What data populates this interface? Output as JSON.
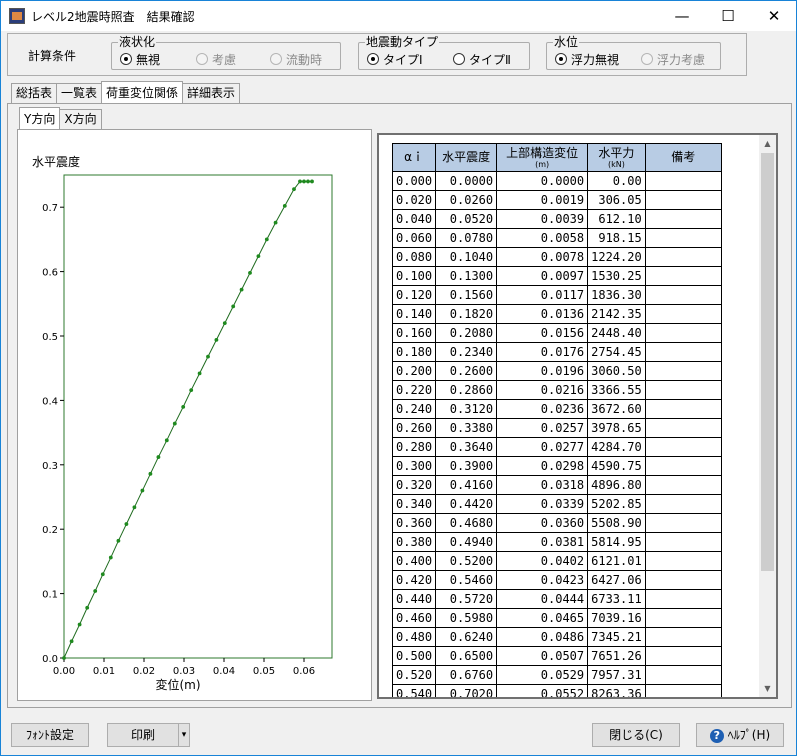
{
  "window": {
    "title": "レベル2地震時照査　結果確認",
    "minimize": "—",
    "maximize": "☐",
    "close": "✕"
  },
  "conditions": {
    "label": "計算条件",
    "liquefaction": {
      "title": "液状化",
      "options": [
        "無視",
        "考慮",
        "流動時"
      ],
      "selected": 0
    },
    "motion": {
      "title": "地震動タイプ",
      "options": [
        "タイプⅠ",
        "タイプⅡ"
      ],
      "selected": 0
    },
    "water": {
      "title": "水位",
      "options": [
        "浮力無視",
        "浮力考慮"
      ],
      "selected": 0
    }
  },
  "tabs": [
    "総括表",
    "一覧表",
    "荷重変位関係",
    "詳細表示"
  ],
  "selected_tab": 2,
  "subtabs": [
    "Y方向",
    "X方向"
  ],
  "selected_subtab": 0,
  "chart_data": {
    "type": "line",
    "ylabel": "水平震度",
    "xlabel": "変位(m)",
    "xlim": [
      0,
      0.067
    ],
    "ylim": [
      0,
      0.75
    ],
    "xticks": [
      "0.00",
      "0.01",
      "0.02",
      "0.03",
      "0.04",
      "0.05",
      "0.06"
    ],
    "yticks": [
      "0.0",
      "0.1",
      "0.2",
      "0.3",
      "0.4",
      "0.5",
      "0.6",
      "0.7"
    ],
    "x": [
      0,
      0.0019,
      0.0039,
      0.0058,
      0.0078,
      0.0097,
      0.0117,
      0.0136,
      0.0156,
      0.0176,
      0.0196,
      0.0216,
      0.0236,
      0.0257,
      0.0277,
      0.0298,
      0.0318,
      0.0339,
      0.036,
      0.0381,
      0.0402,
      0.0423,
      0.0444,
      0.0465,
      0.0486,
      0.0507,
      0.0529,
      0.0552,
      0.0575,
      0.059,
      0.06,
      0.061,
      0.062
    ],
    "y": [
      0,
      0.026,
      0.052,
      0.078,
      0.104,
      0.13,
      0.156,
      0.182,
      0.208,
      0.234,
      0.26,
      0.286,
      0.312,
      0.338,
      0.364,
      0.39,
      0.416,
      0.442,
      0.468,
      0.494,
      0.52,
      0.546,
      0.572,
      0.598,
      0.624,
      0.65,
      0.676,
      0.702,
      0.728,
      0.74,
      0.74,
      0.74,
      0.74
    ]
  },
  "table": {
    "headers": [
      "αｉ",
      "水平震度",
      "上部構造変位",
      "水平力",
      "備考"
    ],
    "units": [
      "",
      "",
      "(m)",
      "(kN)",
      ""
    ],
    "rows": [
      [
        "0.000",
        "0.0000",
        "0.0000",
        "0.00"
      ],
      [
        "0.020",
        "0.0260",
        "0.0019",
        "306.05"
      ],
      [
        "0.040",
        "0.0520",
        "0.0039",
        "612.10"
      ],
      [
        "0.060",
        "0.0780",
        "0.0058",
        "918.15"
      ],
      [
        "0.080",
        "0.1040",
        "0.0078",
        "1224.20"
      ],
      [
        "0.100",
        "0.1300",
        "0.0097",
        "1530.25"
      ],
      [
        "0.120",
        "0.1560",
        "0.0117",
        "1836.30"
      ],
      [
        "0.140",
        "0.1820",
        "0.0136",
        "2142.35"
      ],
      [
        "0.160",
        "0.2080",
        "0.0156",
        "2448.40"
      ],
      [
        "0.180",
        "0.2340",
        "0.0176",
        "2754.45"
      ],
      [
        "0.200",
        "0.2600",
        "0.0196",
        "3060.50"
      ],
      [
        "0.220",
        "0.2860",
        "0.0216",
        "3366.55"
      ],
      [
        "0.240",
        "0.3120",
        "0.0236",
        "3672.60"
      ],
      [
        "0.260",
        "0.3380",
        "0.0257",
        "3978.65"
      ],
      [
        "0.280",
        "0.3640",
        "0.0277",
        "4284.70"
      ],
      [
        "0.300",
        "0.3900",
        "0.0298",
        "4590.75"
      ],
      [
        "0.320",
        "0.4160",
        "0.0318",
        "4896.80"
      ],
      [
        "0.340",
        "0.4420",
        "0.0339",
        "5202.85"
      ],
      [
        "0.360",
        "0.4680",
        "0.0360",
        "5508.90"
      ],
      [
        "0.380",
        "0.4940",
        "0.0381",
        "5814.95"
      ],
      [
        "0.400",
        "0.5200",
        "0.0402",
        "6121.01"
      ],
      [
        "0.420",
        "0.5460",
        "0.0423",
        "6427.06"
      ],
      [
        "0.440",
        "0.5720",
        "0.0444",
        "6733.11"
      ],
      [
        "0.460",
        "0.5980",
        "0.0465",
        "7039.16"
      ],
      [
        "0.480",
        "0.6240",
        "0.0486",
        "7345.21"
      ],
      [
        "0.500",
        "0.6500",
        "0.0507",
        "7651.26"
      ],
      [
        "0.520",
        "0.6760",
        "0.0529",
        "7957.31"
      ],
      [
        "0.540",
        "0.7020",
        "0.0552",
        "8263.36"
      ]
    ]
  },
  "footer": {
    "font_button": "ﾌｫﾝﾄ設定",
    "print_button": "印刷",
    "dropdown": "▾",
    "close_button": "閉じる(C)",
    "help_button": "ﾍﾙﾌﾟ(H)",
    "help_icon": "?"
  },
  "scroll": {
    "up": "▲",
    "down": "▼"
  }
}
